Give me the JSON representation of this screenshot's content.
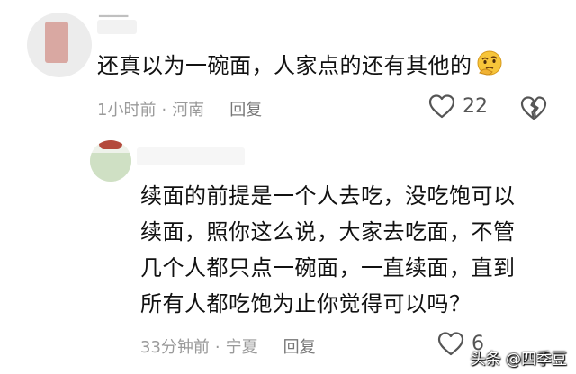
{
  "comments": [
    {
      "text": "还真以为一碗面，人家点的还有其他的",
      "emoji": "thinking-face",
      "time": "1小时前",
      "location": "河南",
      "reply_label": "回复",
      "likes": "22"
    },
    {
      "lines": [
        "续面的前提是一个人去吃，没吃饱可以",
        "续面，照你这么说，大家去吃面，不管",
        "几个人都只点一碗面，一直续面，直到",
        "所有人都吃饱为止你觉得可以吗？"
      ],
      "time": "33分钟前",
      "location": "宁夏",
      "reply_label": "回复",
      "likes": "6"
    }
  ],
  "watermark": "头条 @四季豆"
}
